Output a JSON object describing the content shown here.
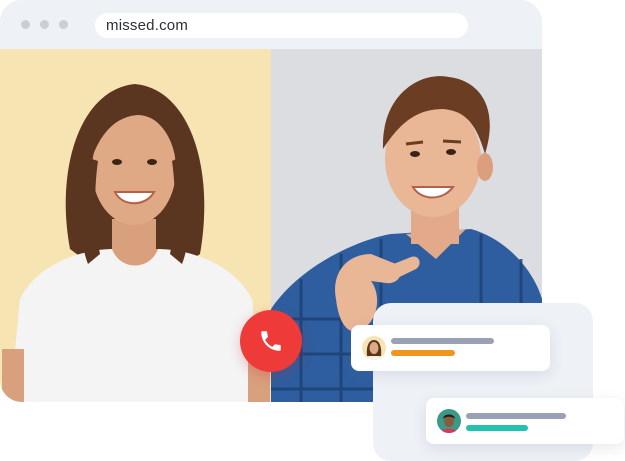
{
  "browser": {
    "url": "missed.com",
    "dots": [
      "window-dot",
      "window-dot",
      "window-dot"
    ]
  },
  "call": {
    "icon": "phone-icon",
    "color": "#ef3a3a"
  },
  "panels": {
    "left_bg": "#f7e4b3",
    "right_bg": "#dcdde0"
  },
  "notifications": [
    {
      "avatar": "avatar-woman",
      "accent_color": "#f0961e"
    },
    {
      "avatar": "avatar-man",
      "accent_color": "#22c1b0"
    }
  ]
}
